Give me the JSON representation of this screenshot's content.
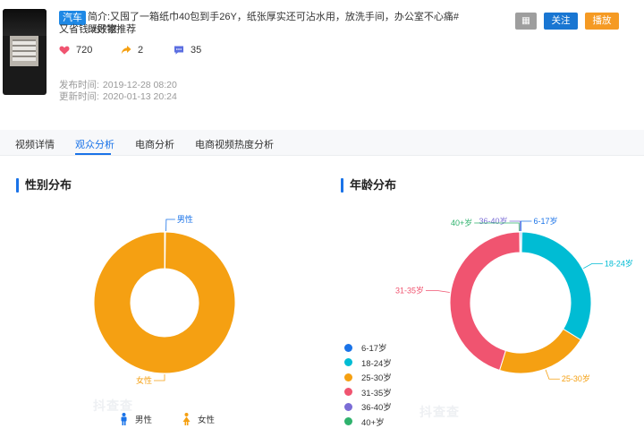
{
  "video": {
    "category_tag": "汽车",
    "intro_line1": "简介:又囤了一箱纸巾40包到手26Y，纸张厚实还可沾水用，放洗手间，办公室不心痛#既败家",
    "intro_line2": "又省钱 #好物推荐",
    "likes": "720",
    "shares": "2",
    "comments": "35",
    "publish_label": "发布时间:",
    "publish_time": "2019-12-28 08:20",
    "update_label": "更新时间:",
    "update_time": "2020-01-13 20:24"
  },
  "actions": {
    "gray_label": "▦",
    "follow_label": "关注",
    "play_label": "播放"
  },
  "tabs": [
    {
      "label": "视频详情"
    },
    {
      "label": "观众分析"
    },
    {
      "label": "电商分析"
    },
    {
      "label": "电商视频热度分析"
    }
  ],
  "gender": {
    "title": "性别分布",
    "legend": [
      {
        "label": "男性",
        "color": "#1a73e8",
        "icon": "male-icon"
      },
      {
        "label": "女性",
        "color": "#f5a012",
        "icon": "female-icon"
      }
    ]
  },
  "age": {
    "title": "年龄分布",
    "legend": [
      {
        "label": "6-17岁",
        "color": "#1a73e8"
      },
      {
        "label": "18-24岁",
        "color": "#00bcd4"
      },
      {
        "label": "25-30岁",
        "color": "#f5a012"
      },
      {
        "label": "31-35岁",
        "color": "#f05470"
      },
      {
        "label": "36-40岁",
        "color": "#7b6dd6"
      },
      {
        "label": "40+岁",
        "color": "#2fb26d"
      }
    ]
  },
  "watermark": "抖查查",
  "chart_data": [
    {
      "type": "pie",
      "donut": true,
      "title": "性别分布",
      "categories": [
        "男性",
        "女性"
      ],
      "values": [
        0.2,
        99.8
      ],
      "colors": [
        "#1a73e8",
        "#f5a012"
      ]
    },
    {
      "type": "pie",
      "donut": true,
      "title": "年龄分布",
      "categories": [
        "6-17岁",
        "18-24岁",
        "25-30岁",
        "31-35岁",
        "36-40岁",
        "40+岁"
      ],
      "values": [
        0.3,
        33.5,
        21,
        45,
        0.1,
        0.1
      ],
      "colors": [
        "#1a73e8",
        "#00bcd4",
        "#f5a012",
        "#f05470",
        "#7b6dd6",
        "#2fb26d"
      ]
    }
  ]
}
